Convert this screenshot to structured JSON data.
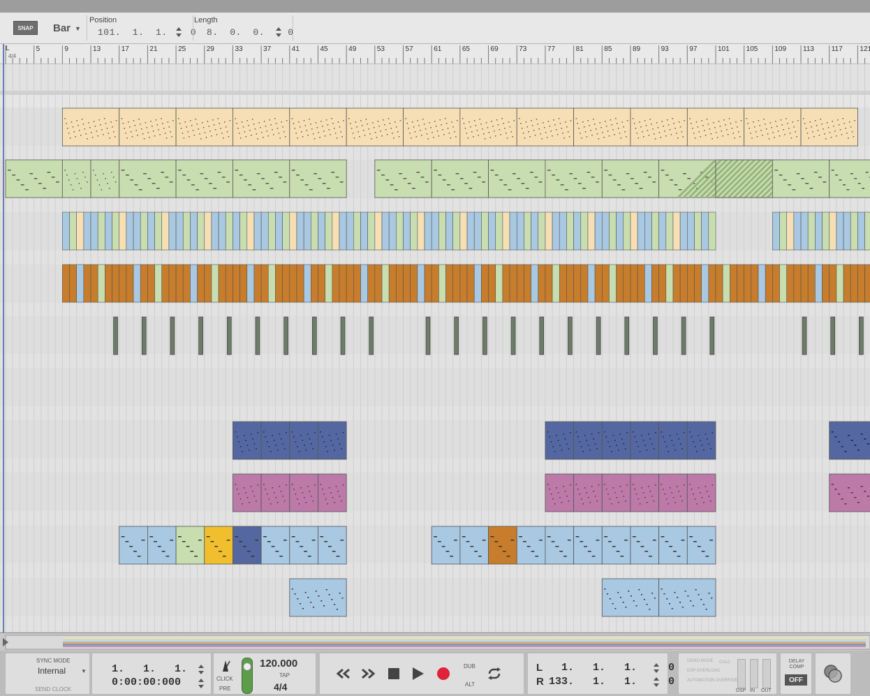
{
  "toolbar": {
    "snap_label": "SNAP",
    "grid_value": "Bar",
    "position_label": "Position",
    "position_value": "101.  1.  1.    0",
    "length_label": "Length",
    "length_value": "8.  0.  0.    0"
  },
  "ruler": {
    "loop_marker": "L",
    "signature": "4/4",
    "bars": [
      "5",
      "9",
      "13",
      "17",
      "21",
      "25",
      "29",
      "33",
      "37",
      "41",
      "45",
      "49",
      "53",
      "57",
      "61",
      "65",
      "69",
      "73",
      "77",
      "81",
      "85",
      "89",
      "93",
      "97",
      "101",
      "105",
      "109",
      "113",
      "117",
      "121"
    ]
  },
  "colors": {
    "sand": "#f6dfb5",
    "green": "#c9deb0",
    "blue": "#a9c8e2",
    "orange": "#c77d2b",
    "dark_green": "#6c7c68",
    "navy": "#5567a0",
    "pink": "#bb7aa8",
    "yellow": "#f1be2e",
    "accent_record": "#e0223a"
  },
  "transport": {
    "sync_mode_label": "SYNC MODE",
    "sync_mode_value": "Internal",
    "send_clock": "SEND CLOCK",
    "song_position_bars": "1.   1.   1.     0",
    "song_position_time": "0:00:00:000",
    "click_label": "CLICK",
    "pre_label": "PRE",
    "tempo": "120.000",
    "tap_label": "TAP",
    "time_signature": "4/4",
    "dub_label": "DUB",
    "alt_label": "ALT",
    "loop_left_label": "L",
    "loop_left_value": "1.   1.   1.     0",
    "loop_right_label": "R",
    "loop_right_value": "133.   1.   1.     0",
    "demo_mode": "DEMO MODE",
    "dsp_overload": "DSP OVERLOAD",
    "automation_override": "AUTOMATION OVERRIDE",
    "calc_label": "CALC",
    "dsp_label": "DSP",
    "in_label": "IN",
    "out_label": "OUT",
    "delay_comp_label": "DELAY COMP",
    "delay_comp_value": "OFF"
  }
}
